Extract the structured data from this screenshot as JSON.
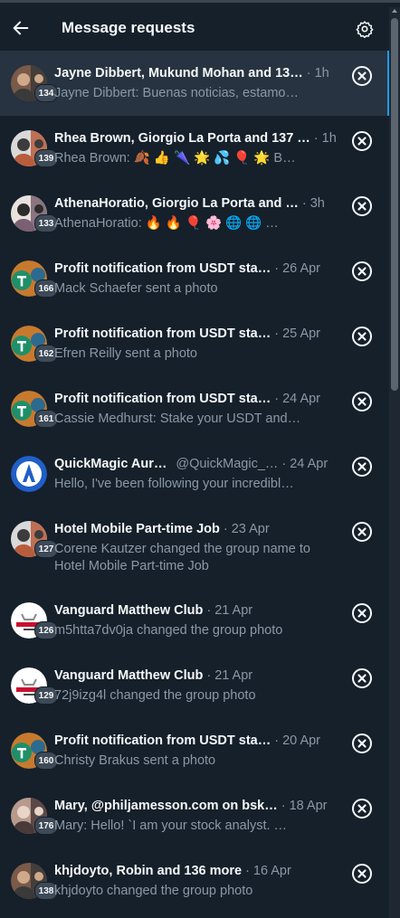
{
  "header": {
    "title": "Message requests",
    "back_icon": "arrow-left-icon",
    "settings_icon": "gear-icon"
  },
  "colors": {
    "background": "#15202b",
    "active_row": "#273340",
    "accent": "#1d9bf0",
    "secondary_text": "#8b98a5"
  },
  "requests": [
    {
      "name": "Jayne Dibbert, Mukund Mohan and 13…",
      "handle": "",
      "time": "1h",
      "preview": "Jayne Dibbert: Buenas noticias, estamo…",
      "count": "134",
      "avatar": "group-avatar"
    },
    {
      "name": "Rhea Brown, Giorgio La Porta and 137 …",
      "handle": "",
      "time": "1h",
      "preview": "Rhea Brown: 🍂 👍 🌂 🌟 💦 🎈 🌟 B…",
      "count": "139",
      "avatar": "group-avatar"
    },
    {
      "name": "AthenaHoratio, Giorgio La Porta and …",
      "handle": "",
      "time": "3h",
      "preview": "AthenaHoratio: 🔥 🔥 🎈 🌸 🌐 🌐 …",
      "count": "133",
      "avatar": "group-avatar"
    },
    {
      "name": "Profit notification from USDT sta…",
      "handle": "",
      "time": "26 Apr",
      "preview": "Mack Schaefer sent a photo",
      "count": "166",
      "avatar": "usdt-avatar"
    },
    {
      "name": "Profit notification from USDT sta…",
      "handle": "",
      "time": "25 Apr",
      "preview": "Efren Reilly sent a photo",
      "count": "162",
      "avatar": "usdt-avatar"
    },
    {
      "name": "Profit notification from USDT sta…",
      "handle": "",
      "time": "24 Apr",
      "preview": "Cassie Medhurst: Stake your USDT and…",
      "count": "161",
      "avatar": "usdt-avatar"
    },
    {
      "name": "QuickMagic Aur…",
      "handle": "@QuickMagic_…",
      "time": "24 Apr",
      "preview": "Hello, I've been following your incredibl…",
      "count": "",
      "avatar": "quickmagic-avatar"
    },
    {
      "name": "Hotel Mobile Part-time Job",
      "handle": "",
      "time": "23 Apr",
      "preview": "Corene Kautzer changed the group name to Hotel Mobile Part-time Job",
      "count": "127",
      "avatar": "group-avatar"
    },
    {
      "name": "Vanguard Matthew Club",
      "handle": "",
      "time": "21 Apr",
      "preview": "m5htta7dv0ja changed the group photo",
      "count": "126",
      "avatar": "vanguard-avatar"
    },
    {
      "name": "Vanguard Matthew Club",
      "handle": "",
      "time": "21 Apr",
      "preview": "72j9izg4l changed the group photo",
      "count": "129",
      "avatar": "vanguard-avatar"
    },
    {
      "name": "Profit notification from USDT sta…",
      "handle": "",
      "time": "20 Apr",
      "preview": "Christy Brakus sent a photo",
      "count": "160",
      "avatar": "usdt-avatar"
    },
    {
      "name": "Mary, @philjamesson.com on bsk…",
      "handle": "",
      "time": "18 Apr",
      "preview": "Mary: Hello! `I am your stock   analyst. …",
      "count": "176",
      "avatar": "group-avatar"
    },
    {
      "name": "khjdoyto, Robin and 136 more",
      "handle": "",
      "time": "16 Apr",
      "preview": "khjdoyto changed the group photo",
      "count": "138",
      "avatar": "group-avatar"
    }
  ]
}
